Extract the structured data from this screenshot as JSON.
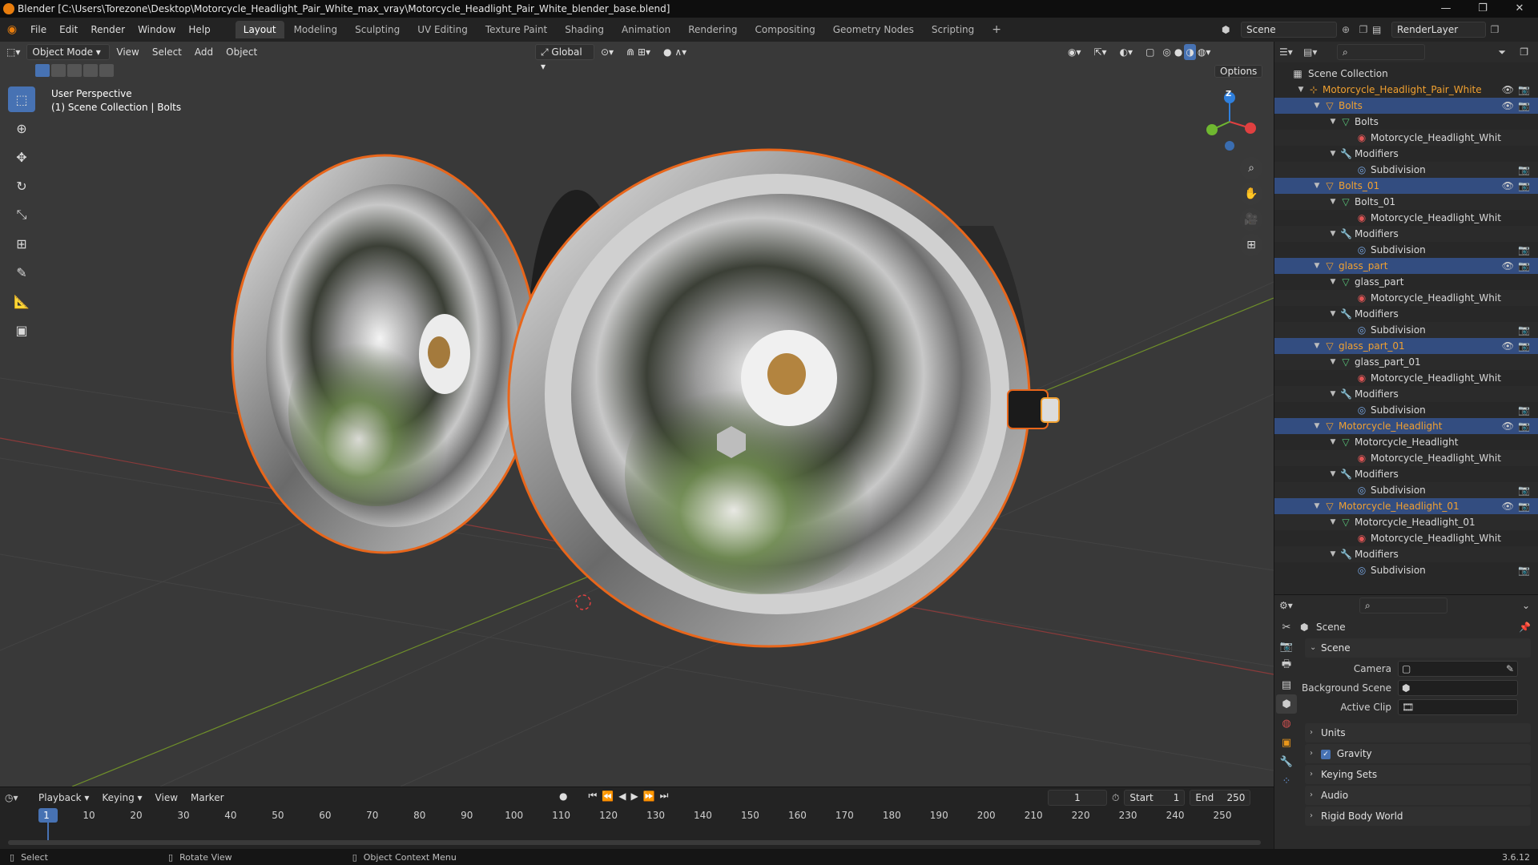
{
  "window": {
    "title": "Blender [C:\\Users\\Torezone\\Desktop\\Motorcycle_Headlight_Pair_White_max_vray\\Motorcycle_Headlight_Pair_White_blender_base.blend]",
    "controls": [
      "—",
      "❐",
      "✕"
    ]
  },
  "menus": [
    "File",
    "Edit",
    "Render",
    "Window",
    "Help"
  ],
  "workspaces": [
    "Layout",
    "Modeling",
    "Sculpting",
    "UV Editing",
    "Texture Paint",
    "Shading",
    "Animation",
    "Rendering",
    "Compositing",
    "Geometry Nodes",
    "Scripting"
  ],
  "active_workspace": "Layout",
  "scene_field": "Scene",
  "renderlayer_field": "RenderLayer",
  "viewport": {
    "mode": "Object Mode",
    "menus": [
      "View",
      "Select",
      "Add",
      "Object"
    ],
    "transform_orientation": "Global",
    "options_label": "Options",
    "overlay_line1": "User Perspective",
    "overlay_line2": "(1) Scene Collection | Bolts",
    "gizmo_axis_label": "Z"
  },
  "outliner": {
    "root": "Scene Collection",
    "rows": [
      {
        "label": "Motorcycle_Headlight_Pair_White",
        "depth": 1,
        "type": "empty",
        "sel": false,
        "eye": true
      },
      {
        "label": "Bolts",
        "depth": 2,
        "type": "object",
        "sel": true,
        "eye": true
      },
      {
        "label": "Bolts",
        "depth": 3,
        "type": "mesh",
        "sel": false,
        "eye": false
      },
      {
        "label": "Motorcycle_Headlight_Whit",
        "depth": 4,
        "type": "material",
        "sel": false,
        "eye": false
      },
      {
        "label": "Modifiers",
        "depth": 3,
        "type": "modifiers",
        "sel": false,
        "eye": false
      },
      {
        "label": "Subdivision",
        "depth": 4,
        "type": "subsurf",
        "sel": false,
        "eye": false,
        "cam": true
      },
      {
        "label": "Bolts_01",
        "depth": 2,
        "type": "object",
        "sel": true,
        "eye": true
      },
      {
        "label": "Bolts_01",
        "depth": 3,
        "type": "mesh",
        "sel": false,
        "eye": false
      },
      {
        "label": "Motorcycle_Headlight_Whit",
        "depth": 4,
        "type": "material",
        "sel": false,
        "eye": false
      },
      {
        "label": "Modifiers",
        "depth": 3,
        "type": "modifiers",
        "sel": false,
        "eye": false
      },
      {
        "label": "Subdivision",
        "depth": 4,
        "type": "subsurf",
        "sel": false,
        "eye": false,
        "cam": true
      },
      {
        "label": "glass_part",
        "depth": 2,
        "type": "object",
        "sel": true,
        "eye": true
      },
      {
        "label": "glass_part",
        "depth": 3,
        "type": "mesh",
        "sel": false,
        "eye": false
      },
      {
        "label": "Motorcycle_Headlight_Whit",
        "depth": 4,
        "type": "material",
        "sel": false,
        "eye": false
      },
      {
        "label": "Modifiers",
        "depth": 3,
        "type": "modifiers",
        "sel": false,
        "eye": false
      },
      {
        "label": "Subdivision",
        "depth": 4,
        "type": "subsurf",
        "sel": false,
        "eye": false,
        "cam": true
      },
      {
        "label": "glass_part_01",
        "depth": 2,
        "type": "object",
        "sel": true,
        "eye": true
      },
      {
        "label": "glass_part_01",
        "depth": 3,
        "type": "mesh",
        "sel": false,
        "eye": false
      },
      {
        "label": "Motorcycle_Headlight_Whit",
        "depth": 4,
        "type": "material",
        "sel": false,
        "eye": false
      },
      {
        "label": "Modifiers",
        "depth": 3,
        "type": "modifiers",
        "sel": false,
        "eye": false
      },
      {
        "label": "Subdivision",
        "depth": 4,
        "type": "subsurf",
        "sel": false,
        "eye": false,
        "cam": true
      },
      {
        "label": "Motorcycle_Headlight",
        "depth": 2,
        "type": "object",
        "sel": true,
        "eye": true
      },
      {
        "label": "Motorcycle_Headlight",
        "depth": 3,
        "type": "mesh",
        "sel": false,
        "eye": false
      },
      {
        "label": "Motorcycle_Headlight_Whit",
        "depth": 4,
        "type": "material",
        "sel": false,
        "eye": false
      },
      {
        "label": "Modifiers",
        "depth": 3,
        "type": "modifiers",
        "sel": false,
        "eye": false
      },
      {
        "label": "Subdivision",
        "depth": 4,
        "type": "subsurf",
        "sel": false,
        "eye": false,
        "cam": true
      },
      {
        "label": "Motorcycle_Headlight_01",
        "depth": 2,
        "type": "object",
        "sel": true,
        "eye": true
      },
      {
        "label": "Motorcycle_Headlight_01",
        "depth": 3,
        "type": "mesh",
        "sel": false,
        "eye": false
      },
      {
        "label": "Motorcycle_Headlight_Whit",
        "depth": 4,
        "type": "material",
        "sel": false,
        "eye": false
      },
      {
        "label": "Modifiers",
        "depth": 3,
        "type": "modifiers",
        "sel": false,
        "eye": false
      },
      {
        "label": "Subdivision",
        "depth": 4,
        "type": "subsurf",
        "sel": false,
        "eye": false,
        "cam": true
      }
    ]
  },
  "properties": {
    "context": "Scene",
    "panel_scene": "Scene",
    "camera_label": "Camera",
    "bg_scene_label": "Background Scene",
    "active_clip_label": "Active Clip",
    "collapsed_panels": [
      "Units",
      "Gravity",
      "Keying Sets",
      "Audio",
      "Rigid Body World"
    ],
    "gravity_checked": true
  },
  "timeline": {
    "menus": [
      "Playback",
      "Keying",
      "View",
      "Marker"
    ],
    "current_frame": "1",
    "start_label": "Start",
    "start_value": "1",
    "end_label": "End",
    "end_value": "250",
    "ruler": [
      "1",
      "10",
      "20",
      "30",
      "40",
      "50",
      "60",
      "70",
      "80",
      "90",
      "100",
      "110",
      "120",
      "130",
      "140",
      "150",
      "160",
      "170",
      "180",
      "190",
      "200",
      "210",
      "220",
      "230",
      "240",
      "250"
    ]
  },
  "statusbar": {
    "select": "Select",
    "rotate": "Rotate View",
    "context_menu": "Object Context Menu",
    "version": "3.6.12"
  },
  "colors": {
    "accent_blue": "#4772b3",
    "selection_orange": "#e8661b",
    "object_orange": "#f0a030",
    "mesh_green": "#59c67a",
    "material_red": "#e05555",
    "modifier_blue": "#7aa9e6"
  }
}
